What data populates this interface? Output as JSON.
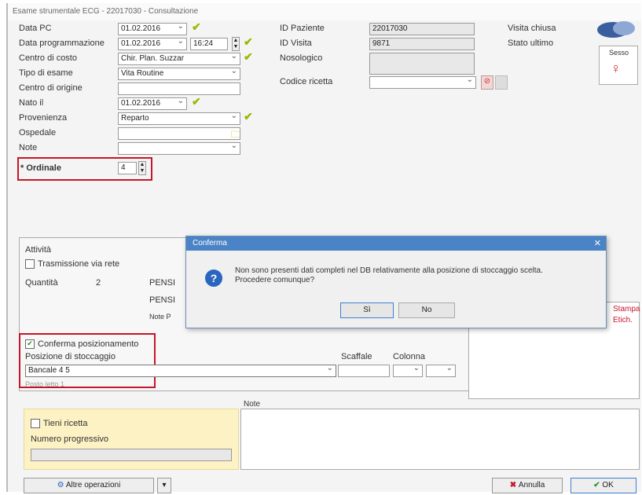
{
  "window": {
    "title": "Esame strumentale ECG - 22017030 - Consultazione"
  },
  "form": {
    "data_pc": {
      "label": "Data PC",
      "value": "01.02.2016"
    },
    "data_programmazione": {
      "label": "Data programmazione",
      "value": "01.02.2016",
      "time": "16:24"
    },
    "centro_di_costo": {
      "label": "Centro di costo",
      "value": "Chir. Plan. Suzzar"
    },
    "tipo_di_esame": {
      "label": "Tipo di esame",
      "value": "Vita Routine"
    },
    "centro_di_origine": {
      "label": "Centro di origine",
      "value": ""
    },
    "nato_il": {
      "label": "Nato il",
      "value": "01.02.2016"
    },
    "provenienza": {
      "label": "Provenienza",
      "value": "Reparto"
    },
    "ospedale": {
      "label": "Ospedale",
      "value": ""
    },
    "note": {
      "label": "Note",
      "value": ""
    },
    "ordinale": {
      "label": "* Ordinale",
      "value": "4"
    }
  },
  "right_fields": {
    "id_paziente": {
      "label": "ID Paziente",
      "value": "22017030"
    },
    "id_visita": {
      "label": "ID Visita",
      "value": "9871"
    },
    "nosologico": {
      "label": "Nosologico",
      "value": ""
    },
    "cod_ricetta": {
      "label": "Codice ricetta",
      "value": ""
    },
    "stato_visita": "Visita chiusa",
    "stato_ultimo": "Stato ultimo",
    "sesso_label": "Sesso"
  },
  "section": {
    "header": "Attività",
    "checkbox_label": "Trasmissione via rete",
    "quantita_label": "Quantità",
    "quantita_value": "2",
    "partial1": "PENSI",
    "partial2": "PENSI",
    "partial3": "Note P"
  },
  "posizione": {
    "checkbox_label": "Conferma posizionamento",
    "label": "Posizione di stoccaggio",
    "value": "Bancale 4 5",
    "extra": "Posto letto 1",
    "scaffale_label": "Scaffale",
    "colonna_label": "Colonna"
  },
  "side_text": {
    "line1": "Stampa",
    "line2": "Etich."
  },
  "note_panel": {
    "label": "Note"
  },
  "yellow_panel": {
    "checkbox_label": "Tieni ricetta",
    "field_label": "Numero progressivo"
  },
  "bottom": {
    "altre_operazioni": "Altre operazioni",
    "annulla": "Annulla",
    "ok": "OK"
  },
  "dialog": {
    "title": "Conferma",
    "message_line1": "Non sono presenti dati completi nel DB relativamente alla posizione di stoccaggio scelta.",
    "message_line2": "Procedere comunque?",
    "yes_label": "Sì",
    "no_label": "No"
  },
  "colors": {
    "accent": "#4a83c6",
    "check": "#9ab800",
    "highlight_border": "#c4162a",
    "note_bg": "#fdf2c4"
  }
}
